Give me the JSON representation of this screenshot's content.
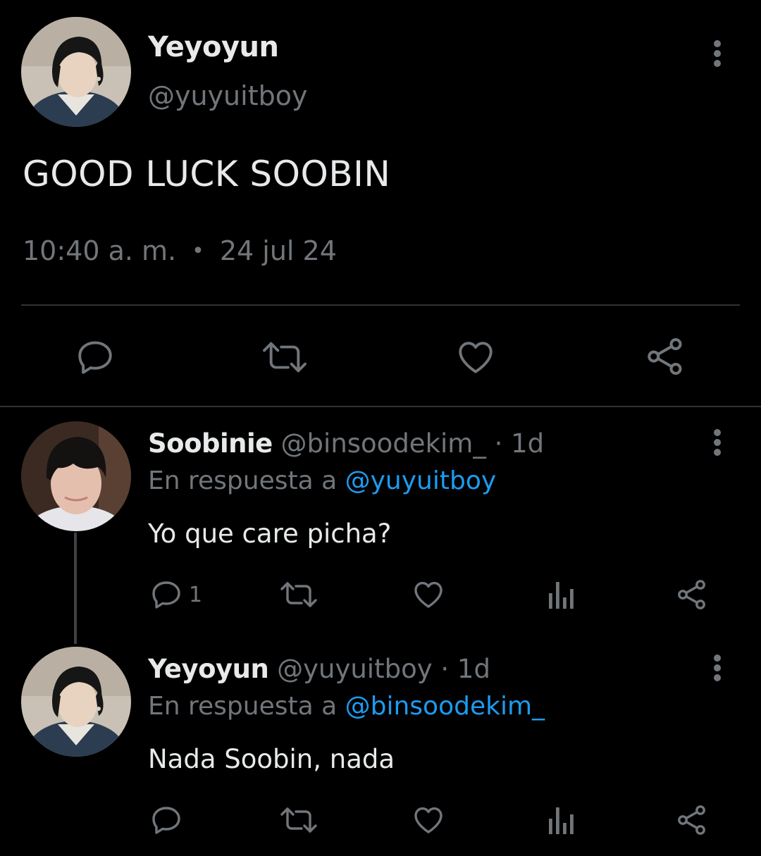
{
  "main_tweet": {
    "display_name": "Yeyoyun",
    "handle": "@yuyuitboy",
    "text": "GOOD LUCK SOOBIN",
    "time": "10:40 a. m.",
    "separator": "•",
    "date": "24 jul 24",
    "more_icon": "more-vertical-icon",
    "actions": [
      {
        "icon": "reply-icon"
      },
      {
        "icon": "retweet-icon"
      },
      {
        "icon": "like-icon"
      },
      {
        "icon": "share-icon"
      }
    ]
  },
  "replies": [
    {
      "display_name": "Soobinie",
      "handle": "@binsoodekim_",
      "separator": "·",
      "age": "1d",
      "reply_prefix": "En respuesta a",
      "reply_to": "@yuyuitboy",
      "text": "Yo que care picha?",
      "reply_count": "1",
      "actions": [
        "reply-icon",
        "retweet-icon",
        "like-icon",
        "views-icon",
        "share-icon"
      ]
    },
    {
      "display_name": "Yeyoyun",
      "handle": "@yuyuitboy",
      "separator": "·",
      "age": "1d",
      "reply_prefix": "En respuesta a",
      "reply_to": "@binsoodekim_",
      "text": "Nada Soobin, nada",
      "reply_count": "",
      "actions": [
        "reply-icon",
        "retweet-icon",
        "like-icon",
        "views-icon",
        "share-icon"
      ]
    }
  ],
  "colors": {
    "background": "#000000",
    "primary_text": "#e7e9ea",
    "secondary_text": "#71767b",
    "accent": "#1d9bf0",
    "divider": "#2f3336"
  }
}
